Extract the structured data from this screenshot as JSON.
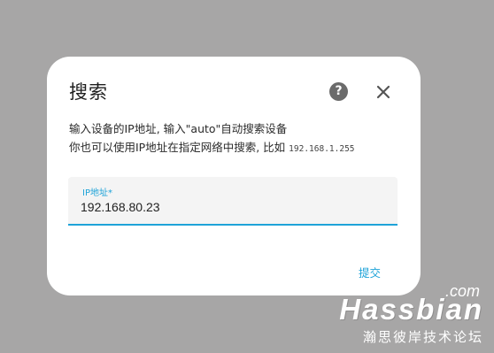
{
  "dialog": {
    "title": "搜索",
    "help_icon": "help-circle-icon",
    "close_icon": "close-icon",
    "description_line1": "输入设备的IP地址, 输入\"auto\"自动搜索设备",
    "description_line2": "你也可以使用IP地址在指定网络中搜索, 比如",
    "description_example": "192.168.1.255",
    "field": {
      "label": "IP地址*",
      "value": "192.168.80.23"
    },
    "submit_label": "提交"
  },
  "watermark": {
    "com": ".com",
    "brand": "Hassbian",
    "tagline": "瀚思彼岸技术论坛"
  },
  "colors": {
    "overlay": "#a7a6a6",
    "accent": "#1ea3d8",
    "icon": "#6b6b6b"
  }
}
